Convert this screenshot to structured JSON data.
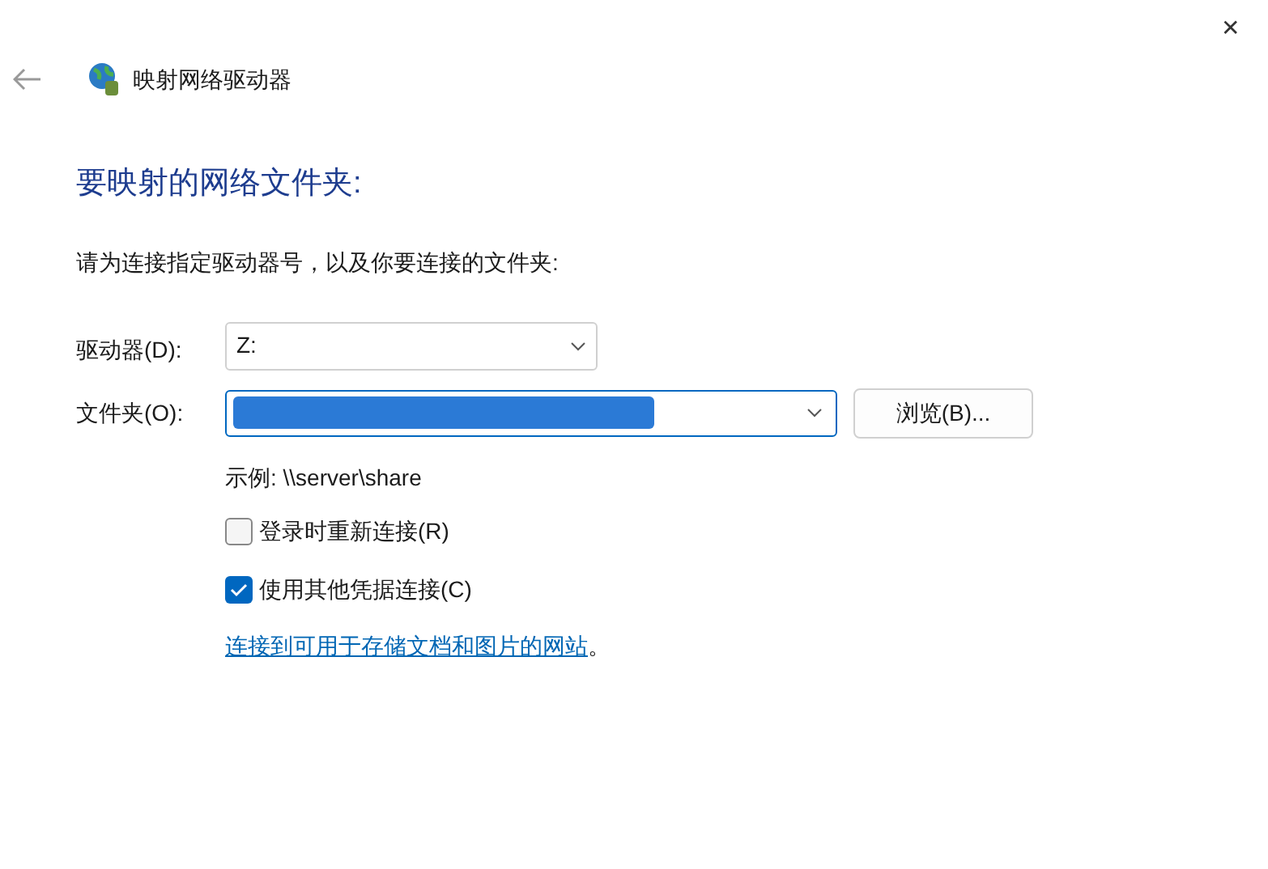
{
  "window": {
    "title": "映射网络驱动器",
    "close": "✕"
  },
  "heading": "要映射的网络文件夹:",
  "instruction": "请为连接指定驱动器号，以及你要连接的文件夹:",
  "drive": {
    "label": "驱动器(D):",
    "value": "Z:"
  },
  "folder": {
    "label": "文件夹(O):",
    "redacted": true
  },
  "browse_button": "浏览(B)...",
  "example": "示例: \\\\server\\share",
  "options": [
    {
      "label": "登录时重新连接(R)",
      "checked": false
    },
    {
      "label": "使用其他凭据连接(C)",
      "checked": true
    }
  ],
  "link": {
    "text": "连接到可用于存储文档和图片的网站",
    "suffix": "。"
  }
}
